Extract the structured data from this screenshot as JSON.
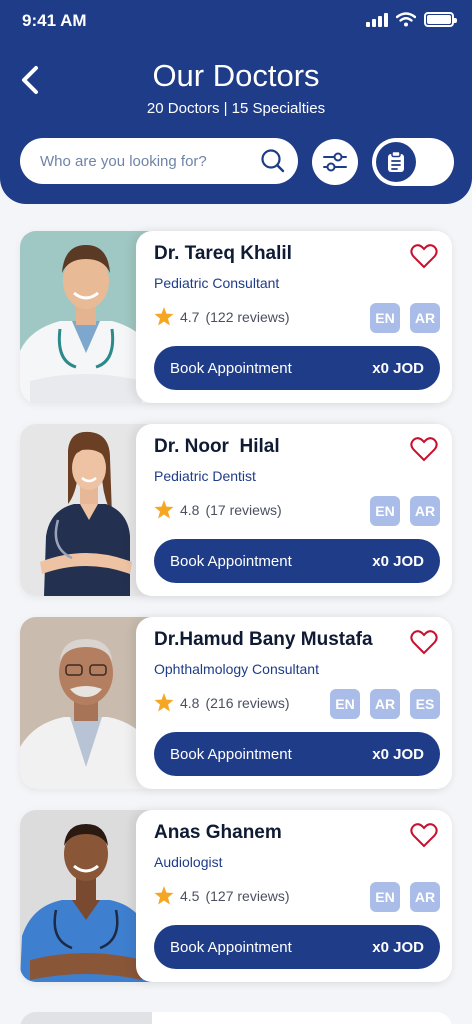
{
  "status": {
    "time": "9:41 AM"
  },
  "header": {
    "title": "Our Doctors",
    "subtitle": "20 Doctors | 15 Specialties",
    "search_placeholder": "Who are you looking for?"
  },
  "colors": {
    "primary": "#1f3c88",
    "lang_badge": "#a9bde8",
    "heart": "#c8102e",
    "star": "#f5a623"
  },
  "doctors": [
    {
      "name": "Dr. Tareq Khalil",
      "specialty": "Pediatric Consultant",
      "rating": "4.7",
      "reviews": "(122 reviews)",
      "languages": [
        "EN",
        "AR"
      ],
      "book_label": "Book Appointment",
      "price": "x0 JOD"
    },
    {
      "name": "Dr. Noor  Hilal",
      "specialty": "Pediatric Dentist",
      "rating": "4.8",
      "reviews": "(17 reviews)",
      "languages": [
        "EN",
        "AR"
      ],
      "book_label": "Book Appointment",
      "price": "x0 JOD"
    },
    {
      "name": "Dr.Hamud Bany Mustafa",
      "specialty": "Ophthalmology Consultant",
      "rating": "4.8",
      "reviews": "(216 reviews)",
      "languages": [
        "EN",
        "AR",
        "ES"
      ],
      "book_label": "Book Appointment",
      "price": "x0 JOD"
    },
    {
      "name": "Anas Ghanem",
      "specialty": "Audiologist",
      "rating": "4.5",
      "reviews": "(127 reviews)",
      "languages": [
        "EN",
        "AR"
      ],
      "book_label": "Book Appointment",
      "price": "x0 JOD"
    }
  ]
}
